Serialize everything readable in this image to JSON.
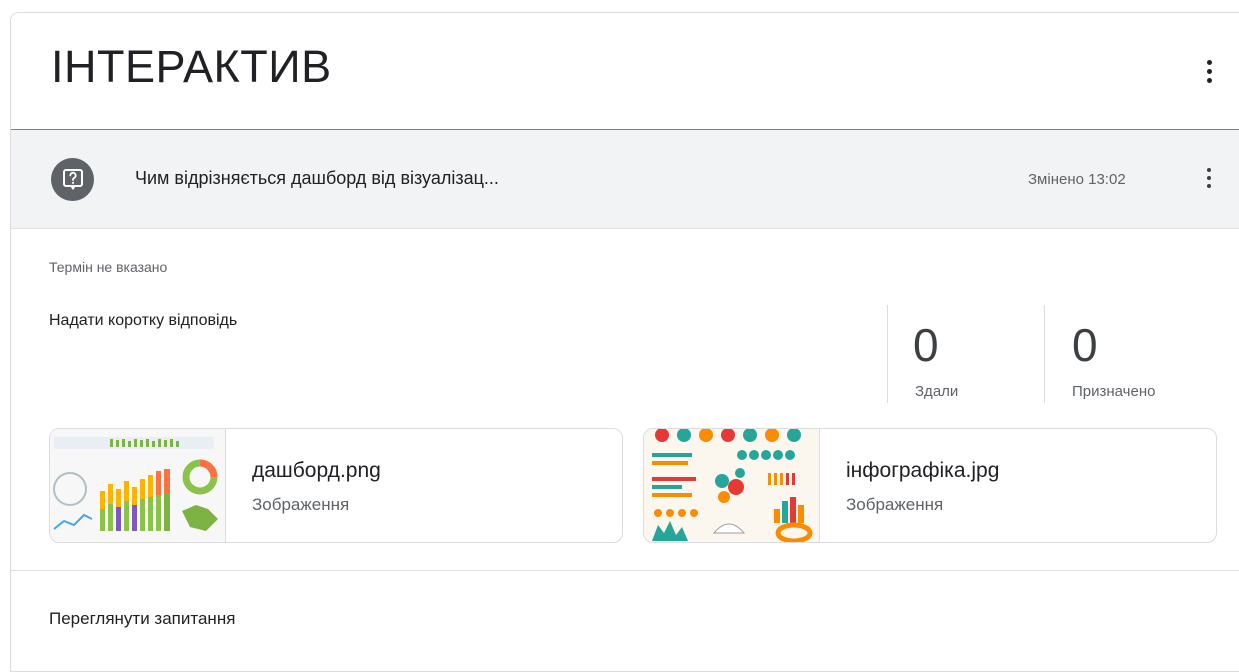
{
  "header": {
    "title": "ІНТЕРАКТИВ"
  },
  "question": {
    "text": "Чим відрізняється дашборд від візуалізац...",
    "modified": "Змінено 13:02"
  },
  "details": {
    "deadline": "Термін не вказано",
    "instruction": "Надати коротку відповідь"
  },
  "stats": [
    {
      "value": "0",
      "label": "Здали"
    },
    {
      "value": "0",
      "label": "Призначено"
    }
  ],
  "attachments": [
    {
      "name": "дашборд.png",
      "type": "Зображення"
    },
    {
      "name": "інфографіка.jpg",
      "type": "Зображення"
    }
  ],
  "footer": {
    "view_link": "Переглянути запитання"
  },
  "colors": {
    "icon_bg": "#5f6368",
    "question_bar": "#f1f3f4",
    "border": "#dadce0"
  },
  "icons": {
    "question": "question-bubble-icon",
    "more": "more-vert-icon"
  }
}
